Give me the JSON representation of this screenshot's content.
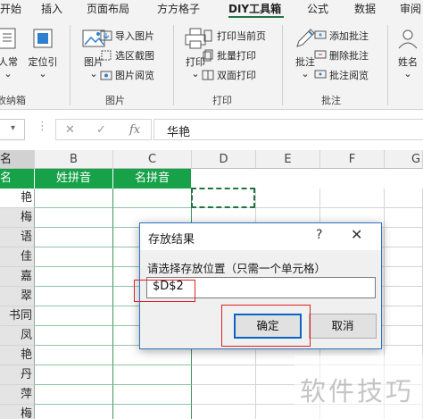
{
  "ribbon_tabs": [
    "开始",
    "插入",
    "页面布局",
    "方方格子",
    "DIY工具箱",
    "公式",
    "数据",
    "审阅"
  ],
  "active_tab": "DIY工具箱",
  "ribbon": {
    "group1": {
      "btn1_label": "人常",
      "btn2_label": "定位引",
      "label": "收纳箱"
    },
    "picture_group": {
      "label": "图片",
      "big_button": "图片",
      "items": [
        "导入图片",
        "选区截图",
        "图片阅览"
      ]
    },
    "print_group": {
      "label": "打印",
      "big_button": "打印",
      "items": [
        "打印当前页",
        "批量打印",
        "双面打印"
      ]
    },
    "comment_group": {
      "label": "批注",
      "big_button": "批注",
      "items": [
        "添加批注",
        "删除批注",
        "批注阅览"
      ]
    },
    "name_group": {
      "big_button": "姓名"
    }
  },
  "formula_bar": {
    "fx": "fx",
    "value": "华艳"
  },
  "columns": [
    "名",
    "B",
    "C",
    "D",
    "E",
    "F",
    "G"
  ],
  "header_row": {
    "b": "姓拼音",
    "c": "名拼音"
  },
  "column_a_values": [
    "艳",
    "梅",
    "语",
    "佳",
    "嘉",
    "翠",
    "书同",
    "凤",
    "艳",
    "丹",
    "萍",
    "梅"
  ],
  "dialog": {
    "title": "存放结果",
    "help": "?",
    "close": "✕",
    "prompt": "请选择存放位置（只需一个单元格）",
    "input_value": "$D$2",
    "ok_label": "确定",
    "cancel_label": "取消"
  },
  "watermark": "软件技巧",
  "colors": {
    "accent": "#217346",
    "header_green": "#17a24a",
    "dialog_border": "#2c75c8",
    "highlight_red": "#e02020"
  }
}
